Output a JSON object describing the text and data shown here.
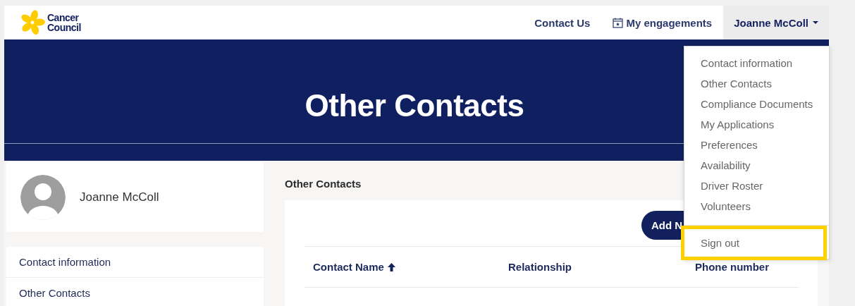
{
  "header": {
    "logo": {
      "text": "Cancer Council"
    },
    "nav": [
      {
        "kind": "link",
        "label": "Contact Us"
      },
      {
        "kind": "calendar-link",
        "label": "My engagements"
      }
    ],
    "user_menu": {
      "label": "Joanne McColl",
      "expanded": true,
      "items": [
        {
          "label": "Contact information"
        },
        {
          "label": "Other Contacts"
        },
        {
          "label": "Compliance Documents"
        },
        {
          "label": "My Applications"
        },
        {
          "label": "Preferences"
        },
        {
          "label": "Availability"
        },
        {
          "label": "Driver Roster"
        },
        {
          "label": "Volunteers"
        }
      ],
      "sign_out": {
        "label": "Sign out",
        "highlighted": true
      }
    }
  },
  "hero": {
    "title": "Other Contacts"
  },
  "sidebar": {
    "profile": {
      "name": "Joanne McColl"
    },
    "items": [
      {
        "label": "Contact information"
      },
      {
        "label": "Other Contacts"
      }
    ]
  },
  "main": {
    "heading": "Other Contacts",
    "add_button": "Add N",
    "table": {
      "columns": [
        {
          "label": "Contact Name",
          "sorted": true
        },
        {
          "label": "Relationship",
          "sorted": false
        },
        {
          "label": "Phone number",
          "sorted": false
        }
      ]
    }
  }
}
